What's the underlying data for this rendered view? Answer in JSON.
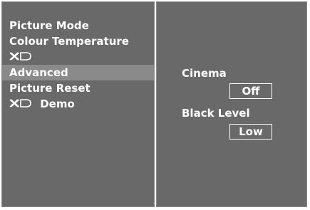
{
  "menu": {
    "items": [
      {
        "label": "Picture Mode"
      },
      {
        "label": "Colour Temperature"
      },
      {
        "label": ""
      },
      {
        "label": "Advanced",
        "selected": true
      },
      {
        "label": "Picture Reset"
      },
      {
        "label": "Demo"
      }
    ],
    "logo_text": "XD"
  },
  "submenu": {
    "cinema_label": "Cinema",
    "cinema_value": "Off",
    "black_level_label": "Black Level",
    "black_level_value": "Low"
  },
  "colors": {
    "panel_bg": "#696969",
    "highlight_bg": "#8a8a8a",
    "text": "#ffffff"
  }
}
